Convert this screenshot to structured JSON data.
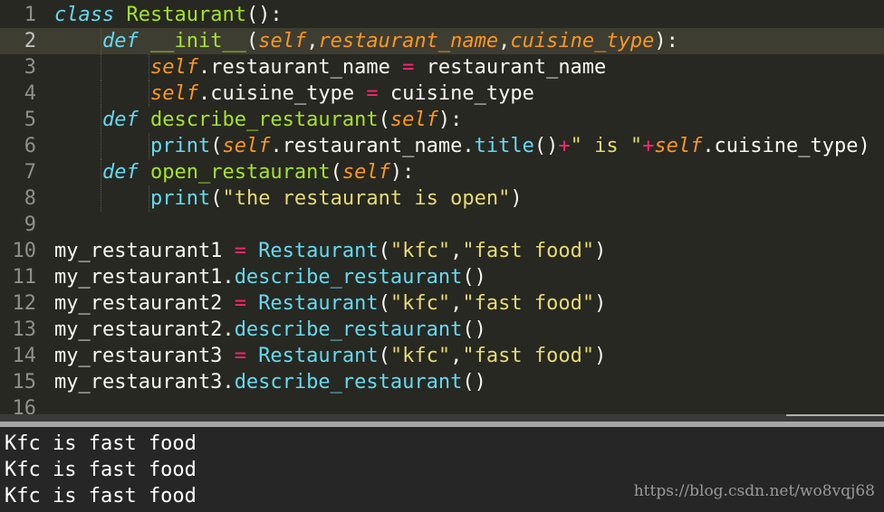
{
  "editor": {
    "active_line": 2,
    "lines": [
      {
        "num": "1",
        "tokens": [
          {
            "t": "class",
            "c": "kw"
          },
          {
            "t": " "
          },
          {
            "t": "Restaurant",
            "c": "cls"
          },
          {
            "t": "():"
          }
        ]
      },
      {
        "num": "2",
        "tokens": [
          {
            "t": "    "
          },
          {
            "t": "def",
            "c": "kw"
          },
          {
            "t": " "
          },
          {
            "t": "__init__",
            "c": "fn"
          },
          {
            "t": "("
          },
          {
            "t": "self",
            "c": "param"
          },
          {
            "t": ","
          },
          {
            "t": "restaurant_name",
            "c": "param"
          },
          {
            "t": ","
          },
          {
            "t": "cuisine_type",
            "c": "param"
          },
          {
            "t": "):"
          }
        ]
      },
      {
        "num": "3",
        "tokens": [
          {
            "t": "        "
          },
          {
            "t": "self",
            "c": "param"
          },
          {
            "t": ".restaurant_name "
          },
          {
            "t": "=",
            "c": "op"
          },
          {
            "t": " restaurant_name"
          }
        ]
      },
      {
        "num": "4",
        "tokens": [
          {
            "t": "        "
          },
          {
            "t": "self",
            "c": "param"
          },
          {
            "t": ".cuisine_type "
          },
          {
            "t": "=",
            "c": "op"
          },
          {
            "t": " cuisine_type"
          }
        ]
      },
      {
        "num": "5",
        "tokens": [
          {
            "t": "    "
          },
          {
            "t": "def",
            "c": "kw"
          },
          {
            "t": " "
          },
          {
            "t": "describe_restaurant",
            "c": "fn"
          },
          {
            "t": "("
          },
          {
            "t": "self",
            "c": "param"
          },
          {
            "t": "):"
          }
        ]
      },
      {
        "num": "6",
        "tokens": [
          {
            "t": "        "
          },
          {
            "t": "print",
            "c": "bi"
          },
          {
            "t": "("
          },
          {
            "t": "self",
            "c": "param"
          },
          {
            "t": ".restaurant_name."
          },
          {
            "t": "title",
            "c": "bi"
          },
          {
            "t": "()"
          },
          {
            "t": "+",
            "c": "op"
          },
          {
            "t": "\" is \"",
            "c": "str"
          },
          {
            "t": "+",
            "c": "op"
          },
          {
            "t": "self",
            "c": "param"
          },
          {
            "t": ".cuisine_type)"
          }
        ]
      },
      {
        "num": "7",
        "tokens": [
          {
            "t": "    "
          },
          {
            "t": "def",
            "c": "kw"
          },
          {
            "t": " "
          },
          {
            "t": "open_restaurant",
            "c": "fn"
          },
          {
            "t": "("
          },
          {
            "t": "self",
            "c": "param"
          },
          {
            "t": "):"
          }
        ]
      },
      {
        "num": "8",
        "tokens": [
          {
            "t": "        "
          },
          {
            "t": "print",
            "c": "bi"
          },
          {
            "t": "("
          },
          {
            "t": "\"the restaurant is open\"",
            "c": "str"
          },
          {
            "t": ")"
          }
        ]
      },
      {
        "num": "9",
        "tokens": []
      },
      {
        "num": "10",
        "tokens": [
          {
            "t": "my_restaurant1 "
          },
          {
            "t": "=",
            "c": "op"
          },
          {
            "t": " "
          },
          {
            "t": "Restaurant",
            "c": "bi"
          },
          {
            "t": "("
          },
          {
            "t": "\"kfc\"",
            "c": "str"
          },
          {
            "t": ","
          },
          {
            "t": "\"fast food\"",
            "c": "str"
          },
          {
            "t": ")"
          }
        ]
      },
      {
        "num": "11",
        "tokens": [
          {
            "t": "my_restaurant1."
          },
          {
            "t": "describe_restaurant",
            "c": "bi"
          },
          {
            "t": "()"
          }
        ]
      },
      {
        "num": "12",
        "tokens": [
          {
            "t": "my_restaurant2 "
          },
          {
            "t": "=",
            "c": "op"
          },
          {
            "t": " "
          },
          {
            "t": "Restaurant",
            "c": "bi"
          },
          {
            "t": "("
          },
          {
            "t": "\"kfc\"",
            "c": "str"
          },
          {
            "t": ","
          },
          {
            "t": "\"fast food\"",
            "c": "str"
          },
          {
            "t": ")"
          }
        ]
      },
      {
        "num": "13",
        "tokens": [
          {
            "t": "my_restaurant2."
          },
          {
            "t": "describe_restaurant",
            "c": "bi"
          },
          {
            "t": "()"
          }
        ]
      },
      {
        "num": "14",
        "tokens": [
          {
            "t": "my_restaurant3 "
          },
          {
            "t": "=",
            "c": "op"
          },
          {
            "t": " "
          },
          {
            "t": "Restaurant",
            "c": "bi"
          },
          {
            "t": "("
          },
          {
            "t": "\"kfc\"",
            "c": "str"
          },
          {
            "t": ","
          },
          {
            "t": "\"fast food\"",
            "c": "str"
          },
          {
            "t": ")"
          }
        ]
      },
      {
        "num": "15",
        "tokens": [
          {
            "t": "my_restaurant3."
          },
          {
            "t": "describe_restaurant",
            "c": "bi"
          },
          {
            "t": "()"
          }
        ]
      },
      {
        "num": "16",
        "tokens": []
      }
    ]
  },
  "console": {
    "output": [
      "Kfc is fast food",
      "Kfc is fast food",
      "Kfc is fast food"
    ]
  },
  "watermark": "https://blog.csdn.net/wo8vqj68",
  "colors": {
    "editor_bg": "#272822",
    "keyword": "#66d9ef",
    "class_name": "#a6e22e",
    "parameter": "#fd971f",
    "operator": "#f92672",
    "string": "#e6db74"
  }
}
